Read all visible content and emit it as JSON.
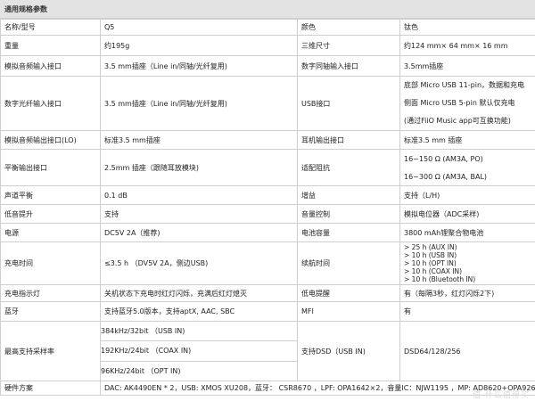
{
  "section_title": "通用规格参数",
  "rows": {
    "r1": [
      "名称/型号",
      "Q5",
      "颜色",
      "钛色"
    ],
    "r2": [
      "重量",
      "约195g",
      "三维尺寸",
      "约124 mm× 64 mm× 16 mm"
    ],
    "r3": [
      "模拟音频输入接口",
      "3.5 mm插座（Line in/同轴/光纤复用)",
      "数字同轴输入接口",
      "3.5mm插座"
    ],
    "r4": [
      "数字光纤输入接口",
      "3.5 mm插座（Line in/同轴/光纤复用)",
      "USB接口"
    ],
    "r4_usb": [
      "底部 Micro USB 11-pin，数据和充电",
      "侧面 Micro USB 5-pin 默认仅充电",
      "(通过FiiO Music app可互换功能)"
    ],
    "r5": [
      "模拟音频输出接口(LO)",
      "标准3.5 mm插座",
      "耳机输出接口",
      "标准3.5 mm 插座"
    ],
    "r6": [
      "平衡输出接口",
      "2.5mm 插座（跟随耳放模块)",
      "适配阻抗"
    ],
    "r6_imp": [
      "16~150 Ω (AM3A, PO)",
      "16~300 Ω (AM3A, BAL)"
    ],
    "r7": [
      "声道平衡",
      "0.1 dB",
      "增益",
      "支持（L/H)"
    ],
    "r8": [
      "低音提升",
      "支持",
      "音量控制",
      "模拟电位器（ADC采样)"
    ],
    "r9": [
      "电源",
      "DC5V 2A（推荐)",
      "电池容量",
      "3800 mAh锂聚合物电池"
    ],
    "r10": [
      "充电时间",
      "≤3.5 h （DV5V 2A，侧边USB)",
      "续航时间"
    ],
    "r10_life": [
      "> 25 h (AUX IN)",
      "> 10 h (USB IN)",
      "> 10 h (OPT IN)",
      "> 10 h (COAX IN)",
      "> 10 h (Bluetooth  IN)"
    ],
    "r11": [
      "充电指示灯",
      "关机状态下充电时红灯闪烁，充满后红灯熄灭",
      "低电提醒",
      "有（每隔3秒，红灯闪烁2下)"
    ],
    "r12": [
      "蓝牙",
      "支持蓝牙5.0版本，支持aptX, AAC, SBC",
      "MFI",
      "有"
    ],
    "r13": [
      "最高支持采样率",
      "支持DSD（USB IN)",
      "DSD64/128/256"
    ],
    "r13_rates": [
      "384kHz/32bit （USB IN)",
      "192KHz/24bit （COAX IN)",
      "96KHz/24bit （OPT IN)"
    ],
    "r14": [
      "硬件方案",
      "DAC: AK4490EN * 2，USB: XMOS XU208，蓝牙： CSR8670 ，LPF: OPA1642×2，音量IC：NJW1195 ，MP: AD8620+OPA926"
    ]
  },
  "watermark": "值 什么值得买"
}
